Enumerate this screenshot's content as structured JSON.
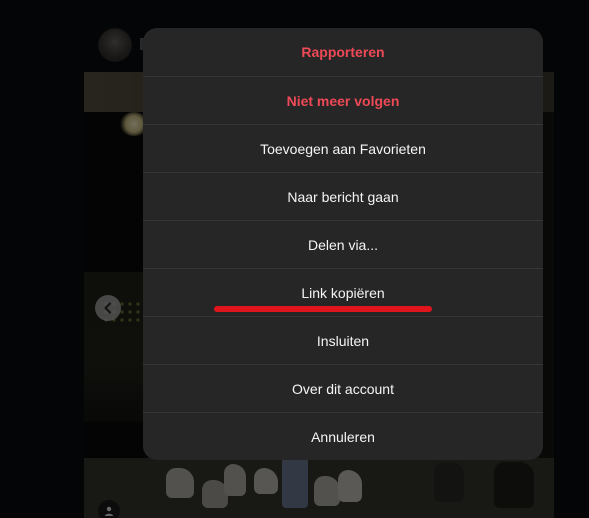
{
  "colors": {
    "dialog_background": "#262626",
    "divider": "#363636",
    "danger_text": "#ed4956",
    "default_text": "#f5f5f5",
    "annotation_underline": "#e0151c"
  },
  "icons": {
    "previous": "chevron-left-icon",
    "user_tag": "user-tag-icon"
  },
  "options_menu": {
    "items": [
      {
        "label": "Rapporteren",
        "style": "danger"
      },
      {
        "label": "Niet meer volgen",
        "style": "danger"
      },
      {
        "label": "Toevoegen aan Favorieten",
        "style": "default"
      },
      {
        "label": "Naar bericht gaan",
        "style": "default"
      },
      {
        "label": "Delen via...",
        "style": "default"
      },
      {
        "label": "Link kopiëren",
        "style": "default",
        "highlighted": true
      },
      {
        "label": "Insluiten",
        "style": "default"
      },
      {
        "label": "Over dit account",
        "style": "default"
      },
      {
        "label": "Annuleren",
        "style": "default"
      }
    ]
  }
}
